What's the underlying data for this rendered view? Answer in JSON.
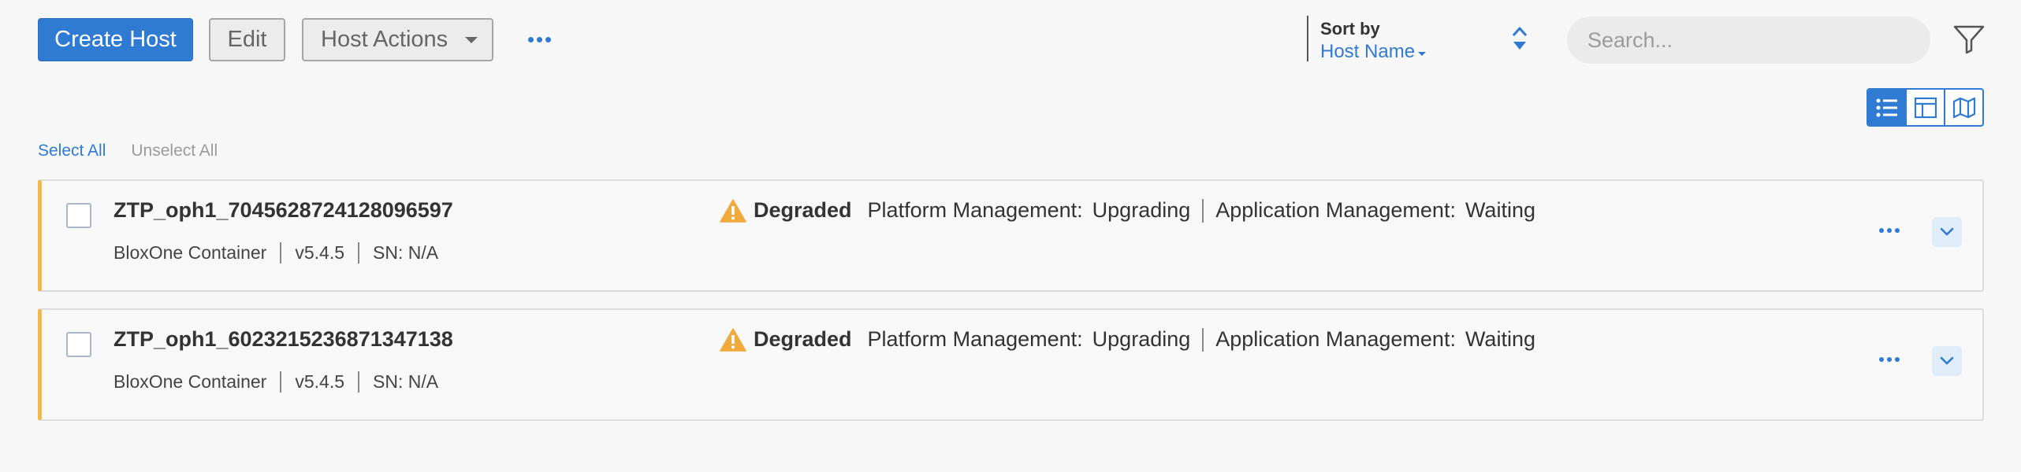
{
  "toolbar": {
    "create_label": "Create Host",
    "edit_label": "Edit",
    "actions_label": "Host Actions"
  },
  "sort": {
    "label": "Sort by",
    "value": "Host Name"
  },
  "search": {
    "placeholder": "Search..."
  },
  "selection": {
    "select_all": "Select All",
    "unselect_all": "Unselect All"
  },
  "hosts": [
    {
      "name": "ZTP_oph1_7045628724128096597",
      "type": "BloxOne Container",
      "version": "v5.4.5",
      "serial": "SN: N/A",
      "status": "Degraded",
      "platform_key": "Platform Management:",
      "platform_value": "Upgrading",
      "application_key": "Application Management:",
      "application_value": "Waiting"
    },
    {
      "name": "ZTP_oph1_6023215236871347138",
      "type": "BloxOne Container",
      "version": "v5.4.5",
      "serial": "SN: N/A",
      "status": "Degraded",
      "platform_key": "Platform Management:",
      "platform_value": "Upgrading",
      "application_key": "Application Management:",
      "application_value": "Waiting"
    }
  ],
  "icons": {
    "more": "more-horizontal-icon",
    "sort": "sort-toggle-icon",
    "filter": "filter-icon",
    "view_list": "list-view-icon",
    "view_card": "layout-view-icon",
    "view_map": "map-view-icon",
    "warning": "warning-icon",
    "expand": "chevron-down-icon"
  },
  "colors": {
    "accent": "#2f7ad3",
    "degraded": "#f0b94b"
  }
}
